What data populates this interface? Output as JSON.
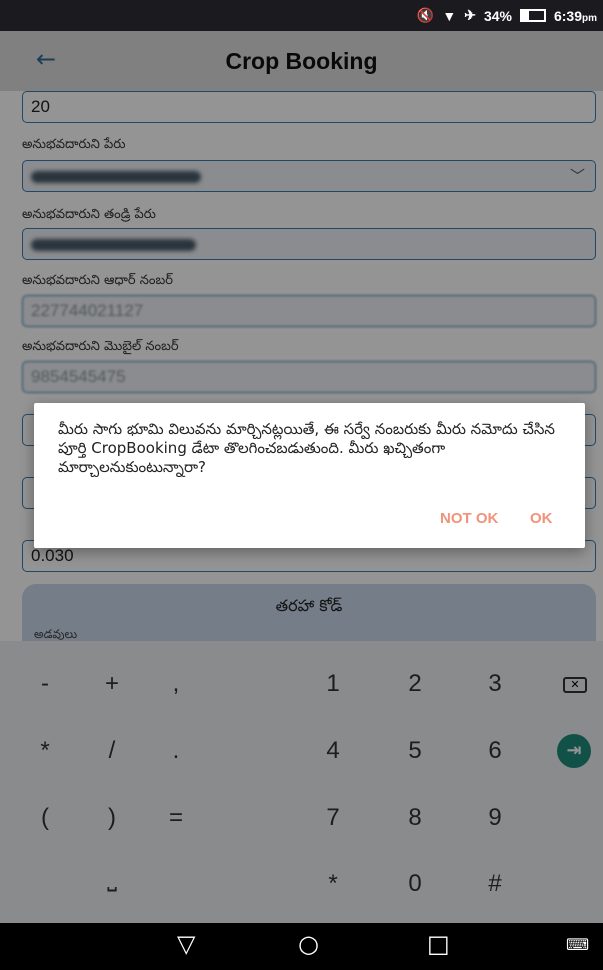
{
  "status_bar": {
    "battery": "34%",
    "time": "6:39",
    "time_suffix": "pm"
  },
  "app_bar": {
    "title": "Crop Booking",
    "back_icon": "←"
  },
  "form": {
    "top_value": "20",
    "labels": {
      "occupant_name": "అనుభవదారుని పేరు",
      "father_name": "అనుభవదారుని తండ్రి పేరు",
      "aadhar": "అనుభవదారుని ఆధార్ నంబర్",
      "mobile": "అనుభవదారుని మొబైల్ నంబర్"
    },
    "aadhar_value": "227744021127",
    "mobile_value": "9854545475",
    "extent_value": "0.030",
    "tarah_title": "తరహా కోడ్",
    "tarah_sub": "అడవులు"
  },
  "dialog": {
    "message": "మీరు సాగు భూమి విలువను మార్చినట్లయితే, ఈ సర్వే నంబరుకు మీరు నమోదు చేసిన పూర్తి CropBooking డేటా తొలగించబడుతుంది. మీరు ఖచ్చితంగా మార్చాలనుకుంటున్నారా?",
    "not_ok": "NOT OK",
    "ok": "OK"
  },
  "keyboard": {
    "row1": [
      "-",
      "+",
      ",",
      "1",
      "2",
      "3"
    ],
    "row2": [
      "*",
      "/",
      ".",
      "4",
      "5",
      "6"
    ],
    "row3": [
      "(",
      ")",
      "=",
      "7",
      "8",
      "9"
    ],
    "row4": [
      "*",
      "0",
      "#"
    ],
    "space_glyph": "⎵",
    "enter_glyph": "⇥"
  },
  "nav": {
    "back": "▽",
    "home": "○",
    "recents": "□"
  }
}
